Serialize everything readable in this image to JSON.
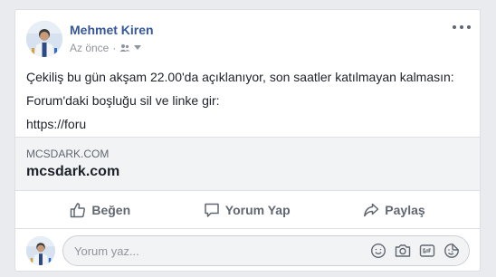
{
  "post": {
    "author": "Mehmet Kiren",
    "timestamp": "Az önce",
    "separator": "·",
    "privacy_icon": "friends-icon",
    "body_lines": [
      "Çekiliş bu gün akşam 22.00'da açıklanıyor, son saatler katılmayan kalmasın:",
      "Forum'daki boşluğu sil ve linke gir:",
      "https://foru"
    ]
  },
  "link_preview": {
    "domain": "MCSDARK.COM",
    "title": "mcsdark.com"
  },
  "actions": {
    "like_label": "Beğen",
    "comment_label": "Yorum Yap",
    "share_label": "Paylaş"
  },
  "comment": {
    "placeholder": "Yorum yaz..."
  },
  "colors": {
    "author_link": "#365899",
    "muted": "#90949c",
    "action_text": "#606770",
    "preview_bg": "#f2f3f5",
    "page_bg": "#e9ebee"
  }
}
